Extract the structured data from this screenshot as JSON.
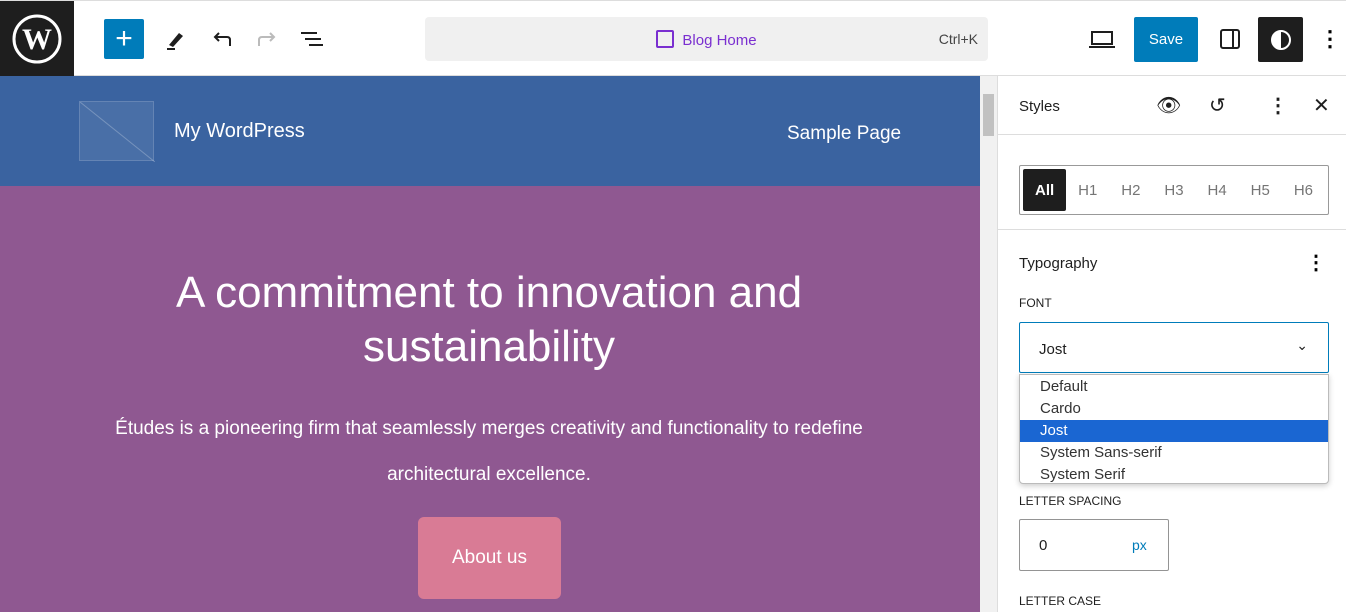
{
  "toolbar": {
    "command_title": "Blog Home",
    "shortcut": "Ctrl+K",
    "save_label": "Save"
  },
  "site": {
    "title": "My WordPress",
    "nav_item": "Sample Page",
    "heading": "A commitment to innovation and sustainability",
    "paragraph": "Études is a pioneering firm that seamlessly merges creativity and functionality to redefine architectural excellence.",
    "button": "About us",
    "colors": {
      "header": "#3a63a0",
      "body": "#8f5891",
      "button": "#d97b95"
    }
  },
  "sidebar": {
    "title": "Styles",
    "elements": [
      "All",
      "H1",
      "H2",
      "H3",
      "H4",
      "H5",
      "H6"
    ],
    "section": "Typography",
    "font_label": "FONT",
    "font_value": "Jost",
    "font_options": [
      "Default",
      "Cardo",
      "Jost",
      "System Sans-serif",
      "System Serif"
    ],
    "letter_spacing_label": "LETTER SPACING",
    "letter_spacing_value": "0",
    "letter_spacing_unit": "px",
    "letter_case_label": "LETTER CASE"
  }
}
